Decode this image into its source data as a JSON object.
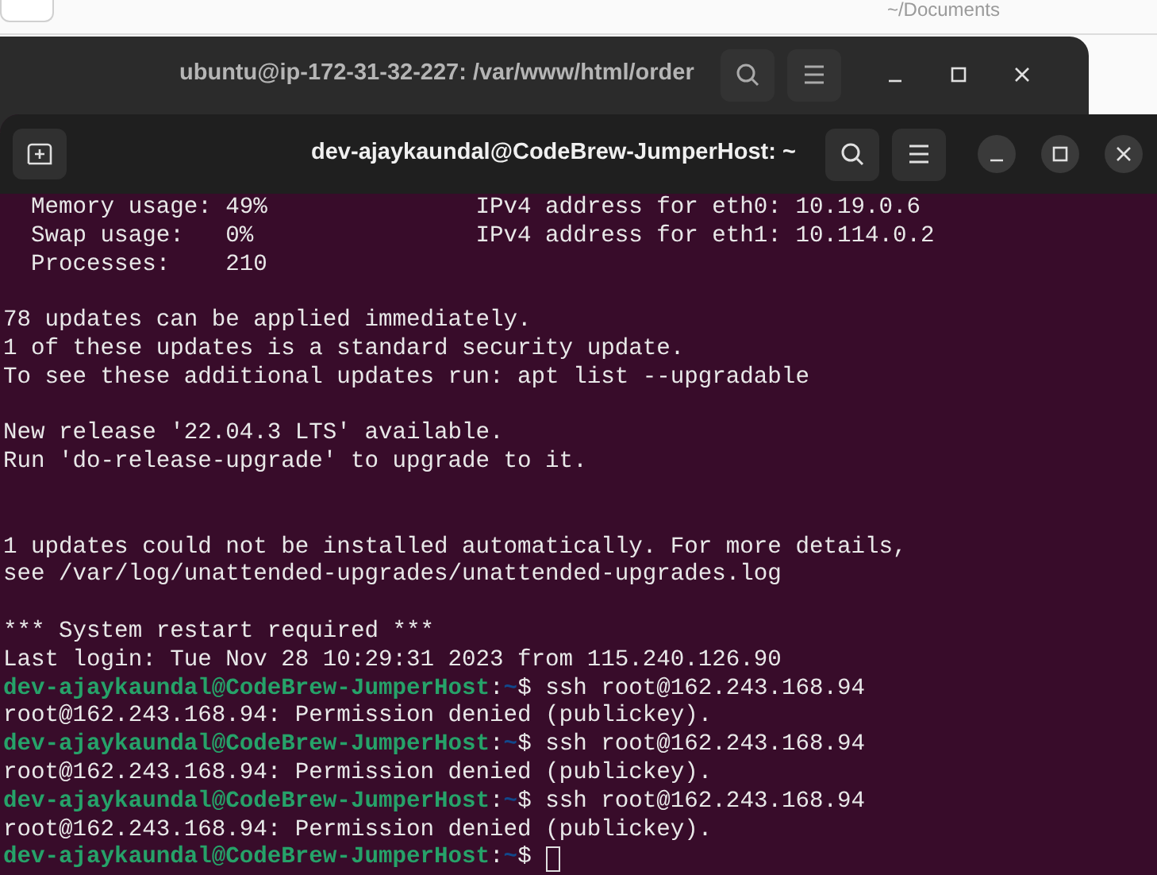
{
  "background_app": {
    "path": "~/Documents"
  },
  "back_window": {
    "title": "ubuntu@ip-172-31-32-227: /var/www/html/order"
  },
  "front_window": {
    "title": "dev-ajaykaundal@CodeBrew-JumperHost: ~"
  },
  "terminal_lines": [
    {
      "kind": "output",
      "text": "  Memory usage: 49%               IPv4 address for eth0: 10.19.0.6"
    },
    {
      "kind": "output",
      "text": "  Swap usage:   0%                IPv4 address for eth1: 10.114.0.2"
    },
    {
      "kind": "output",
      "text": "  Processes:    210"
    },
    {
      "kind": "blank"
    },
    {
      "kind": "output",
      "text": "78 updates can be applied immediately."
    },
    {
      "kind": "output",
      "text": "1 of these updates is a standard security update."
    },
    {
      "kind": "output",
      "text": "To see these additional updates run: apt list --upgradable"
    },
    {
      "kind": "blank"
    },
    {
      "kind": "output",
      "text": "New release '22.04.3 LTS' available."
    },
    {
      "kind": "output",
      "text": "Run 'do-release-upgrade' to upgrade to it."
    },
    {
      "kind": "blank"
    },
    {
      "kind": "blank"
    },
    {
      "kind": "output",
      "text": "1 updates could not be installed automatically. For more details,"
    },
    {
      "kind": "output",
      "text": "see /var/log/unattended-upgrades/unattended-upgrades.log"
    },
    {
      "kind": "blank"
    },
    {
      "kind": "output",
      "text": "*** System restart required ***"
    },
    {
      "kind": "output",
      "text": "Last login: Tue Nov 28 10:29:31 2023 from 115.240.126.90"
    },
    {
      "kind": "prompt",
      "user_host": "dev-ajaykaundal@CodeBrew-JumperHost",
      "separator": ":",
      "path": "~",
      "symbol": "$",
      "command": "ssh root@162.243.168.94"
    },
    {
      "kind": "output",
      "text": "root@162.243.168.94: Permission denied (publickey)."
    },
    {
      "kind": "prompt",
      "user_host": "dev-ajaykaundal@CodeBrew-JumperHost",
      "separator": ":",
      "path": "~",
      "symbol": "$",
      "command": "ssh root@162.243.168.94"
    },
    {
      "kind": "output",
      "text": "root@162.243.168.94: Permission denied (publickey)."
    },
    {
      "kind": "prompt",
      "user_host": "dev-ajaykaundal@CodeBrew-JumperHost",
      "separator": ":",
      "path": "~",
      "symbol": "$",
      "command": "ssh root@162.243.168.94"
    },
    {
      "kind": "output",
      "text": "root@162.243.168.94: Permission denied (publickey)."
    },
    {
      "kind": "prompt",
      "user_host": "dev-ajaykaundal@CodeBrew-JumperHost",
      "separator": ":",
      "path": "~",
      "symbol": "$",
      "cursor": true
    }
  ]
}
